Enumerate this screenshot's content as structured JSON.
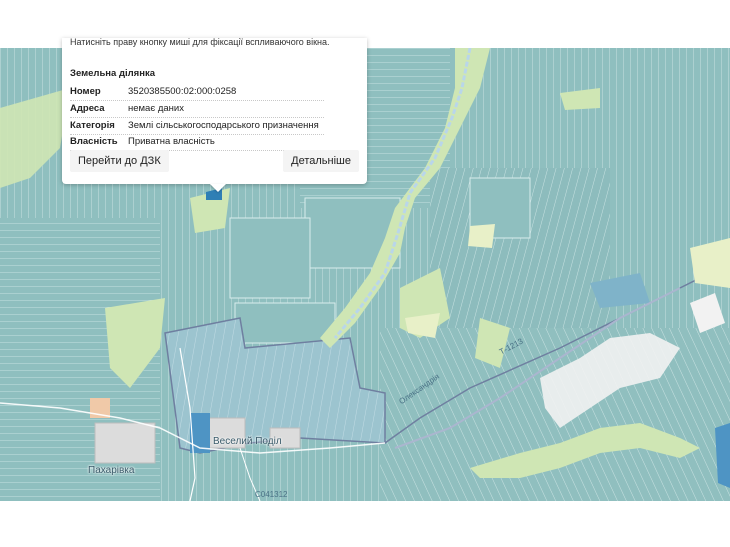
{
  "popup": {
    "hint": "Натисніть праву кнопку миші для фіксації вспливаючого вікна.",
    "title": "Земельна ділянка",
    "rows": [
      {
        "key": "Номер",
        "value": "3520385500:02:000:0258"
      },
      {
        "key": "Адреса",
        "value": "немає даних"
      },
      {
        "key": "Категорія",
        "value": "Землі сільськогосподарського призначення"
      },
      {
        "key": "Власність",
        "value": "Приватна власність"
      }
    ],
    "btn_dzk": "Перейти до ДЗК",
    "btn_details": "Детальніше"
  },
  "map": {
    "places": {
      "veselyi_podil": "Веселий Поділ",
      "pakharivka": "Пахарівка"
    },
    "roads": {
      "road_a": "Т-1213",
      "road_b": "Олександрія",
      "road_c": "С041312"
    },
    "colors": {
      "parcel": "#8fbfbf",
      "parcel_line": "#d8ecec",
      "field_light": "#cfe6b4",
      "settlement": "#dcdcdc",
      "cadastral_zone": "#a9c9d9",
      "river": "#b9d6ea",
      "selected": "#2f7fb5"
    }
  }
}
